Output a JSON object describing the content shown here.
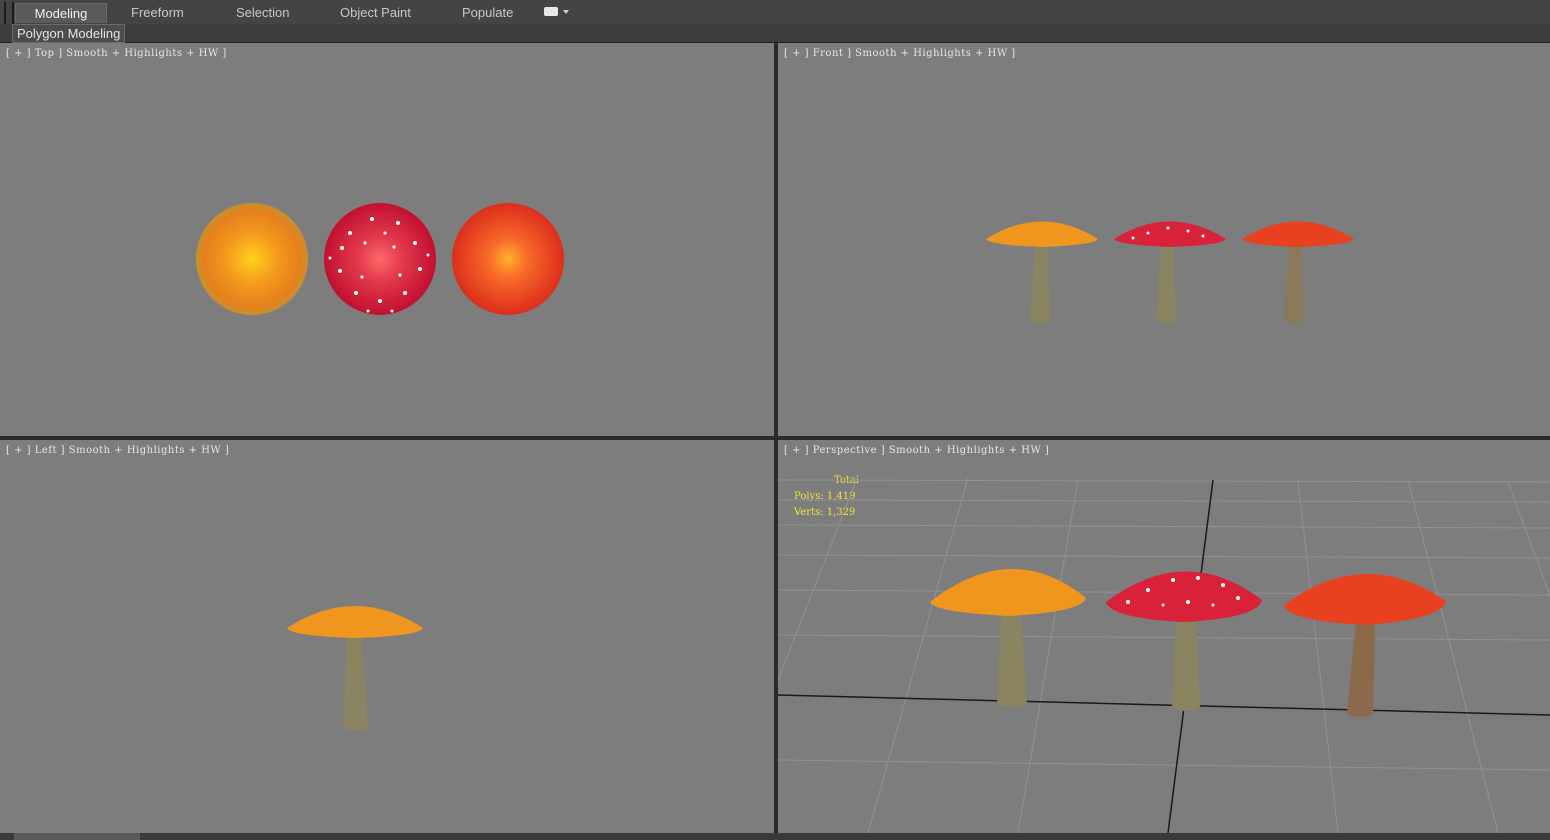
{
  "ribbon": {
    "tabs": [
      {
        "label": "Modeling",
        "active": true
      },
      {
        "label": "Freeform",
        "active": false
      },
      {
        "label": "Selection",
        "active": false
      },
      {
        "label": "Object Paint",
        "active": false
      },
      {
        "label": "Populate",
        "active": false
      }
    ],
    "panel_label": "Polygon Modeling"
  },
  "viewports": {
    "top": {
      "label": "[ + ] Top ] Smooth + Highlights + HW ]"
    },
    "front": {
      "label": "[ + ] Front ] Smooth + Highlights + HW ]"
    },
    "left": {
      "label": "[ + ] Left ] Smooth + Highlights + HW ]"
    },
    "perspective": {
      "label": "[ + ] Perspective ] Smooth + Highlights + HW ]",
      "stats": {
        "title": "Total",
        "polys": "Polys: 1,419",
        "verts": "Verts: 1,329"
      }
    }
  },
  "colors": {
    "viewport_bg": "#7d7d7d",
    "stats_text": "#f2e23a",
    "orange_cap": "#f0961e",
    "red_spotted_cap": "#d9213a",
    "red_cap": "#e8411f"
  },
  "icons": {
    "viewport_menu": "dropdown-icon"
  }
}
